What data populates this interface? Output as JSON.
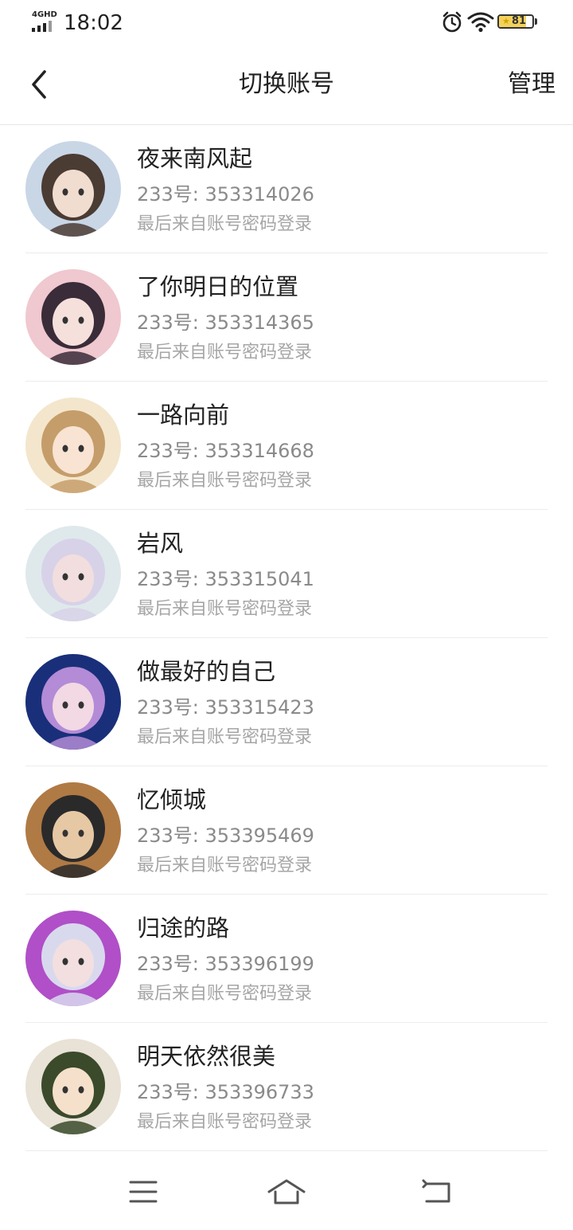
{
  "status_bar": {
    "network": "4GHD",
    "time": "18:02",
    "icons": [
      "alarm-icon",
      "wifi-icon"
    ],
    "battery": {
      "level": 81,
      "label": "81",
      "fill_color": "#f3d25b"
    }
  },
  "header": {
    "title": "切换账号",
    "manage_label": "管理",
    "back_icon": "back-arrow-icon"
  },
  "accounts": [
    {
      "name": "夜来南风起",
      "id_text": "233号: 353314026",
      "login_text": "最后来自账号密码登录",
      "avatar_colors": [
        "#c9d6e6",
        "#4a3b33",
        "#f1dcd0"
      ]
    },
    {
      "name": "了你明日的位置",
      "id_text": "233号: 353314365",
      "login_text": "最后来自账号密码登录",
      "avatar_colors": [
        "#f0c8cf",
        "#3a2c38",
        "#f6e0dc"
      ]
    },
    {
      "name": "一路向前",
      "id_text": "233号: 353314668",
      "login_text": "最后来自账号密码登录",
      "avatar_colors": [
        "#f3e6cd",
        "#c59d6a",
        "#f9e3d2"
      ]
    },
    {
      "name": "岩风",
      "id_text": "233号: 353315041",
      "login_text": "最后来自账号密码登录",
      "avatar_colors": [
        "#dfe9ec",
        "#d7d2e8",
        "#f2dede"
      ]
    },
    {
      "name": "做最好的自己",
      "id_text": "233号: 353315423",
      "login_text": "最后来自账号密码登录",
      "avatar_colors": [
        "#1a2f7a",
        "#b48bd6",
        "#f2d9e4"
      ]
    },
    {
      "name": "忆倾城",
      "id_text": "233号: 353395469",
      "login_text": "最后来自账号密码登录",
      "avatar_colors": [
        "#b07a45",
        "#2a2a2a",
        "#e7c8a5"
      ]
    },
    {
      "name": "归途的路",
      "id_text": "233号: 353396199",
      "login_text": "最后来自账号密码登录",
      "avatar_colors": [
        "#b04fc7",
        "#d9d9ee",
        "#f3dfe0"
      ]
    },
    {
      "name": "明天依然很美",
      "id_text": "233号: 353396733",
      "login_text": "最后来自账号密码登录",
      "avatar_colors": [
        "#e9e2d6",
        "#3a4a2a",
        "#f5e0cc"
      ]
    }
  ],
  "nav_bar": {
    "icons": [
      "menu-icon",
      "home-icon",
      "back-icon"
    ]
  }
}
